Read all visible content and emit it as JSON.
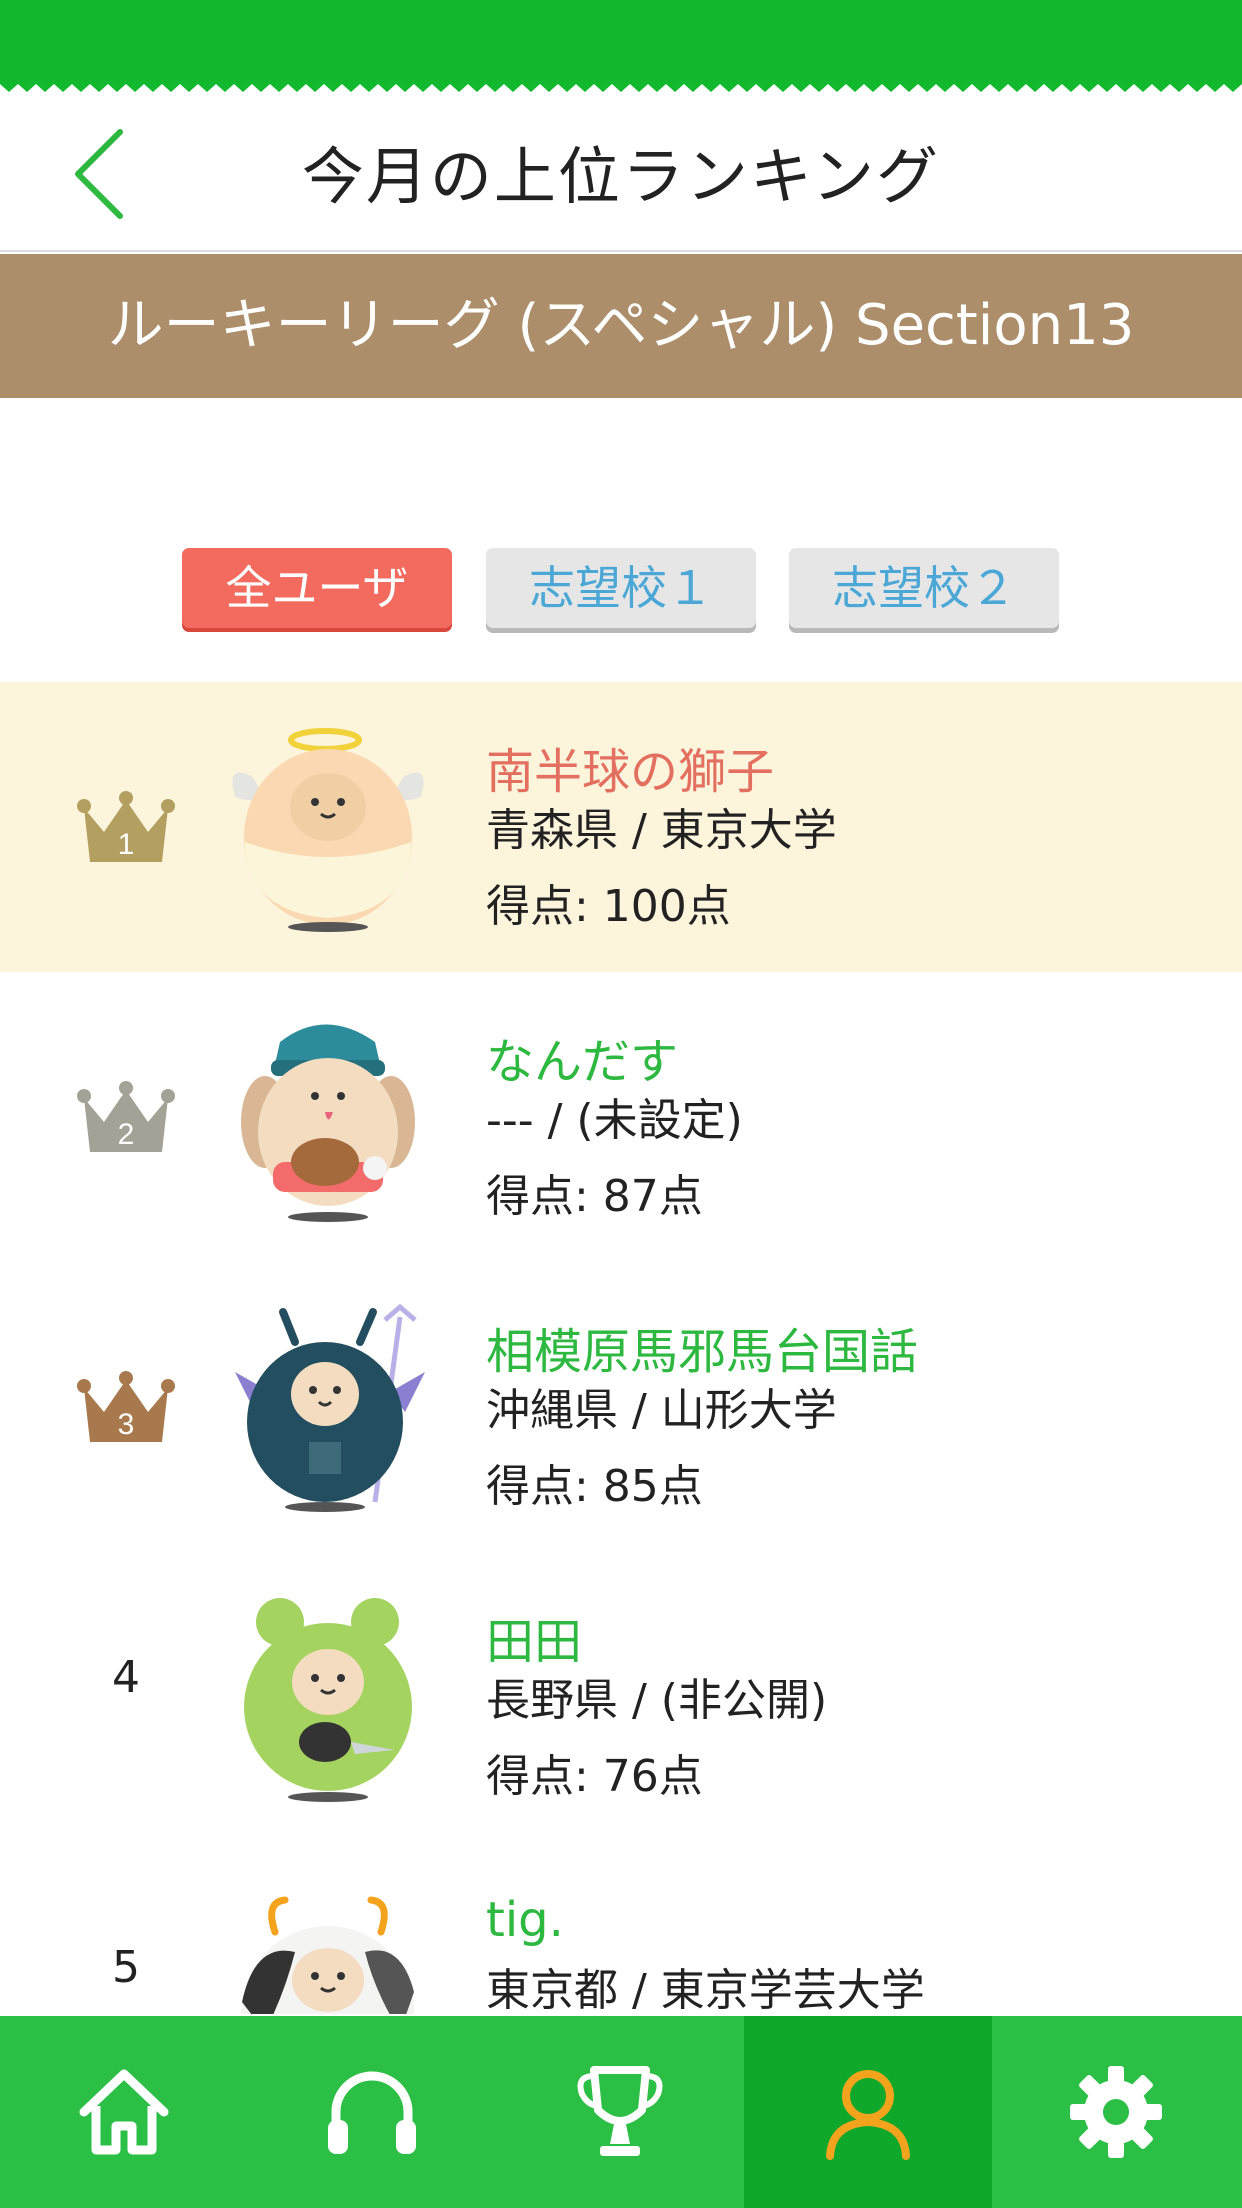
{
  "header": {
    "title": "今月の上位ランキング",
    "back_icon": "chevron-left-icon"
  },
  "league": {
    "label": "ルーキーリーグ (スペシャル) Section13"
  },
  "filter_tabs": [
    {
      "label": "全ユーザ",
      "active": true
    },
    {
      "label": "志望校１",
      "active": false
    },
    {
      "label": "志望校２",
      "active": false
    }
  ],
  "rankings": [
    {
      "rank": "1",
      "name": "南半球の獅子",
      "location": "青森県 / 東京大学",
      "score": "得点: 100点",
      "crown_color": "#b3a060",
      "avatar": "angel-bear-avatar"
    },
    {
      "rank": "2",
      "name": "なんだす",
      "location": "--- / (未設定)",
      "score": "得点: 87点",
      "crown_color": "#a3a296",
      "avatar": "dog-avatar"
    },
    {
      "rank": "3",
      "name": "相模原馬邪馬台国話",
      "location": "沖縄県 / 山形大学",
      "score": "得点: 85点",
      "crown_color": "#a9794e",
      "avatar": "devil-bear-avatar"
    },
    {
      "rank": "4",
      "name": "田田",
      "location": "長野県 / (非公開)",
      "score": "得点: 76点",
      "avatar": "frog-bear-avatar"
    },
    {
      "rank": "5",
      "name": "tig.",
      "location": "東京都 / 東京学芸大学",
      "score": "",
      "avatar": "cow-bear-avatar"
    }
  ],
  "bottom_nav": [
    {
      "icon": "home-icon",
      "active": false
    },
    {
      "icon": "headphones-icon",
      "active": false
    },
    {
      "icon": "trophy-icon",
      "active": false
    },
    {
      "icon": "user-icon",
      "active": true
    },
    {
      "icon": "gear-icon",
      "active": false
    }
  ],
  "colors": {
    "brand_green": "#12b82e",
    "nav_green": "#2cbf45",
    "nav_active": "#0fa82a",
    "league_brown": "#ad8e6a",
    "tab_active": "#f36a5e",
    "highlight_row": "#fdf4dc",
    "name_green": "#2db840",
    "name_first": "#e36f60",
    "user_icon_active": "#f4a31c"
  }
}
